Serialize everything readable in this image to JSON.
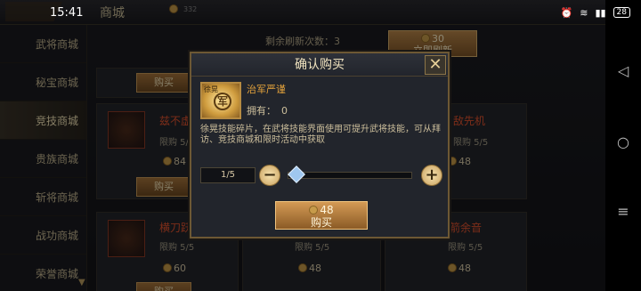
{
  "status": {
    "time": "15:41",
    "battery": "28"
  },
  "topbar": {
    "title": "商城",
    "coins": "332"
  },
  "sidebar": {
    "items": [
      {
        "label": "武将商城"
      },
      {
        "label": "秘宝商城"
      },
      {
        "label": "竞技商城"
      },
      {
        "label": "贵族商城"
      },
      {
        "label": "斩将商城"
      },
      {
        "label": "战功商城"
      },
      {
        "label": "荣誉商城"
      }
    ],
    "active_index": 2
  },
  "shop": {
    "refresh_remaining_label": "剩余刷新次数：",
    "refresh_remaining": "3",
    "refresh_cost": "30",
    "refresh_button": "立即刷新",
    "cards": [
      {
        "name": "",
        "limit": "",
        "price": "",
        "button": "购买"
      },
      {
        "name": "兹不虚发",
        "limit": "限购 5/5",
        "price": "84",
        "button": "购买",
        "badge": "大史慈"
      },
      {
        "name": "敌先机",
        "limit": "限购 5/5",
        "price": "48",
        "button": ""
      },
      {
        "name": "横刀跃马",
        "limit": "限购 5/5",
        "price": "60",
        "button": "购买"
      },
      {
        "name": "",
        "limit": "限购 5/5",
        "price": "48",
        "button": ""
      },
      {
        "name": "箭余音",
        "limit": "限购 5/5",
        "price": "48",
        "button": ""
      }
    ]
  },
  "dialog": {
    "title": "确认购买",
    "item_tag": "徐晃",
    "item_glyph": "军",
    "item_name": "治军严谨",
    "owned_label": "拥有：",
    "owned_value": "0",
    "description": "徐晃技能碎片，在武将技能界面使用可提升武将技能，可从拜访、竞技商城和限时活动中获取",
    "quantity": "1/5",
    "quantity_fraction": 0.0,
    "minus": "−",
    "plus": "+",
    "price": "48",
    "buy_label": "购买"
  },
  "colors": {
    "accent": "#c79b4a",
    "highlight": "#e4532d",
    "name_gold": "#e2a13b"
  }
}
